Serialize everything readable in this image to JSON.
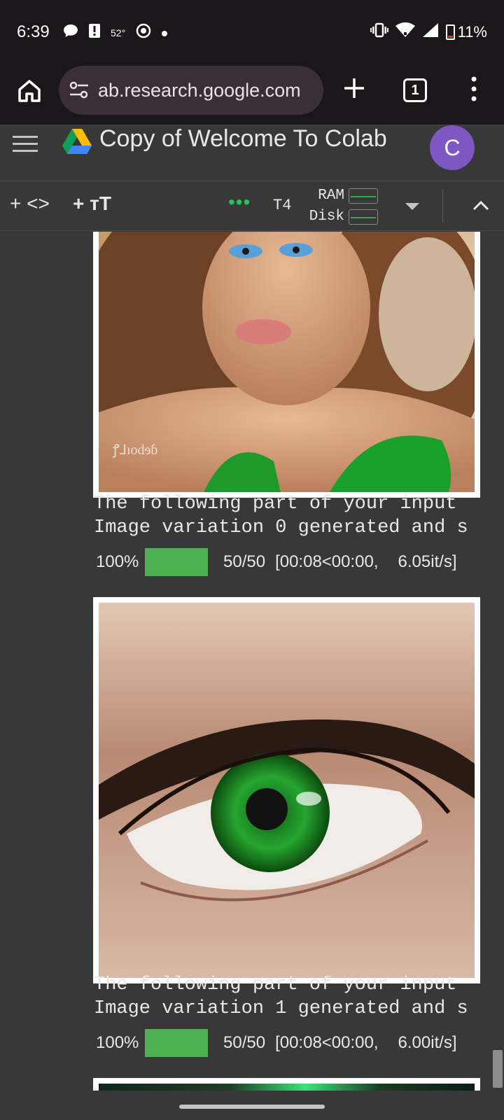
{
  "status_bar": {
    "time": "6:39",
    "temperature": "52°",
    "battery": "11%"
  },
  "browser": {
    "url": "ab.research.google.com",
    "tab_count": "1"
  },
  "colab": {
    "title": "Copy of Welcome To Colab",
    "avatar_letter": "C",
    "toolbar": {
      "add_code": "+ <>",
      "add_text": "+ тT",
      "runtime_status": "•••",
      "runtime_type": "T4",
      "ram_label": "RAM",
      "disk_label": "Disk"
    }
  },
  "outputs": [
    {
      "line1": "The following part of your input ",
      "line2": "Image variation 0 generated and s",
      "progress_percent": "100%",
      "progress_fraction": 1.0,
      "progress_count": "50/50",
      "progress_time": "[00:08<00:00,",
      "progress_rate": "6.05it/s]"
    },
    {
      "line1": "The following part of your input ",
      "line2": "Image variation 1 generated and s",
      "progress_percent": "100%",
      "progress_fraction": 1.0,
      "progress_count": "50/50",
      "progress_time": "[00:08<00:00,",
      "progress_rate": "6.00it/s]"
    }
  ],
  "colors": {
    "status_bg": "#1a1619",
    "page_bg": "#383838",
    "progress_green": "#4caf50",
    "runtime_green": "#21c35b",
    "avatar_purple": "#7e57c2"
  }
}
